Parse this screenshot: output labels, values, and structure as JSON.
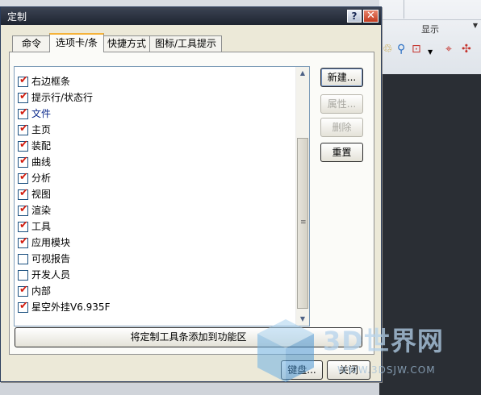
{
  "background": {
    "ribbon_group_label": "显示"
  },
  "dialog": {
    "title": "定制",
    "help_button": "?",
    "close_button": "✕",
    "tabs": [
      {
        "label": "命令"
      },
      {
        "label": "选项卡/条"
      },
      {
        "label": "快捷方式"
      },
      {
        "label": "图标/工具提示"
      }
    ],
    "active_tab": "选项卡/条",
    "list_items": [
      {
        "label": "右边框条",
        "checked": true
      },
      {
        "label": "提示行/状态行",
        "checked": true
      },
      {
        "label": "文件",
        "checked": true
      },
      {
        "label": "主页",
        "checked": true
      },
      {
        "label": "装配",
        "checked": true
      },
      {
        "label": "曲线",
        "checked": true
      },
      {
        "label": "分析",
        "checked": true
      },
      {
        "label": "视图",
        "checked": true
      },
      {
        "label": "渲染",
        "checked": true
      },
      {
        "label": "工具",
        "checked": true
      },
      {
        "label": "应用模块",
        "checked": true
      },
      {
        "label": "可视报告",
        "checked": false
      },
      {
        "label": "开发人员",
        "checked": false
      },
      {
        "label": "内部",
        "checked": true
      },
      {
        "label": "星空外挂V6.935F",
        "checked": true
      }
    ],
    "buttons": {
      "new": "新建...",
      "properties": "属性...",
      "delete": "删除",
      "reset": "重置",
      "add_to_ribbon": "将定制工具条添加到功能区",
      "keyboard": "键盘...",
      "close": "关闭"
    }
  },
  "watermark": {
    "text": "3D世界网",
    "url": "WWW.3DSJW.COM"
  },
  "colors": {
    "title_bar": "#1e2430",
    "checkmark": "#d21d0f",
    "dialog_face": "#ece9d8",
    "highlight_text": "#0b2a8c"
  }
}
